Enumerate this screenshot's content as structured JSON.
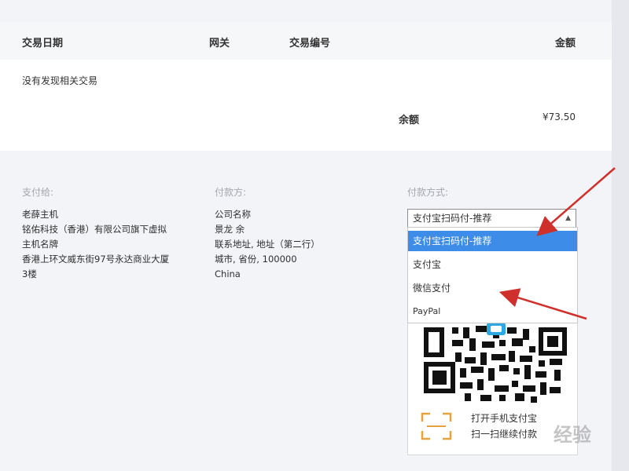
{
  "transactions": {
    "headers": {
      "date": "交易日期",
      "gateway": "网关",
      "txid": "交易编号",
      "amount": "金额"
    },
    "empty_text": "没有发现相关交易",
    "balance_label": "余额",
    "balance_value": "¥73.50"
  },
  "pay_to": {
    "title": "支付给:",
    "lines": [
      "老薛主机",
      "铭佑科技（香港）有限公司旗下虚拟",
      "主机名牌",
      "香港上环文威东街97号永达商业大厦",
      "3楼"
    ]
  },
  "payer": {
    "title": "付款方:",
    "lines": [
      "公司名称",
      "景龙 余",
      "联系地址, 地址（第二行）",
      "城市, 省份, 100000",
      "China"
    ]
  },
  "payment": {
    "title": "付款方式:",
    "selected": "支付宝扫码付-推荐",
    "options": [
      "支付宝扫码付-推荐",
      "支付宝",
      "微信支付",
      "PayPal"
    ],
    "qr_text_line1": "打开手机支付宝",
    "qr_text_line2": "扫一扫继续付款"
  },
  "watermark": "经验",
  "colors": {
    "selected_option": "#3c8ce8",
    "annotation_arrow": "#d0302b",
    "page_bg": "#f3f4f8"
  }
}
